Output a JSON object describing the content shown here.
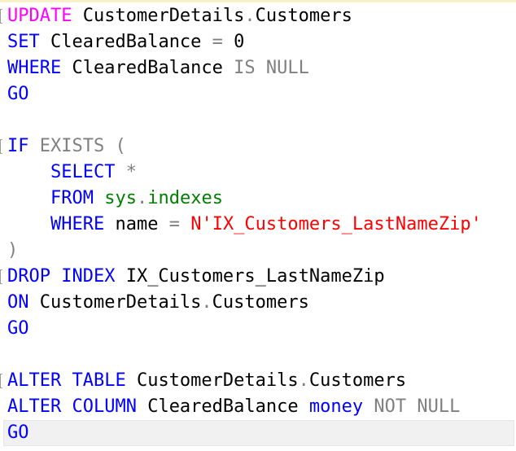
{
  "editor": {
    "colors": {
      "keyword": "#0000ff",
      "operator": "#808080",
      "function": "#ff00ff",
      "system": "#008000",
      "string": "#ff0000",
      "text": "#000000"
    },
    "lines": [
      {
        "tokens": [
          {
            "t": "UPDATE",
            "c": "fn"
          },
          {
            "t": " CustomerDetails",
            "c": "txt"
          },
          {
            "t": ".",
            "c": "op"
          },
          {
            "t": "Customers",
            "c": "txt"
          }
        ]
      },
      {
        "tokens": [
          {
            "t": "SET",
            "c": "kw"
          },
          {
            "t": " ClearedBalance ",
            "c": "txt"
          },
          {
            "t": "=",
            "c": "op"
          },
          {
            "t": " 0",
            "c": "txt"
          }
        ]
      },
      {
        "tokens": [
          {
            "t": "WHERE",
            "c": "kw"
          },
          {
            "t": " ClearedBalance ",
            "c": "txt"
          },
          {
            "t": "IS NULL",
            "c": "op"
          }
        ]
      },
      {
        "tokens": [
          {
            "t": "GO",
            "c": "kw"
          }
        ]
      },
      {
        "tokens": []
      },
      {
        "tokens": [
          {
            "t": "IF",
            "c": "kw"
          },
          {
            "t": " ",
            "c": "txt"
          },
          {
            "t": "EXISTS (",
            "c": "op"
          }
        ]
      },
      {
        "tokens": [
          {
            "t": "    ",
            "c": "txt"
          },
          {
            "t": "SELECT",
            "c": "kw"
          },
          {
            "t": " ",
            "c": "txt"
          },
          {
            "t": "*",
            "c": "op"
          }
        ]
      },
      {
        "tokens": [
          {
            "t": "    ",
            "c": "txt"
          },
          {
            "t": "FROM",
            "c": "kw"
          },
          {
            "t": " ",
            "c": "txt"
          },
          {
            "t": "sys",
            "c": "sys"
          },
          {
            "t": ".",
            "c": "op"
          },
          {
            "t": "indexes",
            "c": "sys"
          }
        ]
      },
      {
        "tokens": [
          {
            "t": "    ",
            "c": "txt"
          },
          {
            "t": "WHERE",
            "c": "kw"
          },
          {
            "t": " name ",
            "c": "txt"
          },
          {
            "t": "=",
            "c": "op"
          },
          {
            "t": " ",
            "c": "txt"
          },
          {
            "t": "N'IX_Customers_LastNameZip'",
            "c": "str"
          }
        ]
      },
      {
        "tokens": [
          {
            "t": ")",
            "c": "op"
          }
        ]
      },
      {
        "tokens": [
          {
            "t": "DROP INDEX",
            "c": "kw"
          },
          {
            "t": " IX_Customers_LastNameZip",
            "c": "txt"
          }
        ]
      },
      {
        "tokens": [
          {
            "t": "ON",
            "c": "kw"
          },
          {
            "t": " CustomerDetails",
            "c": "txt"
          },
          {
            "t": ".",
            "c": "op"
          },
          {
            "t": "Customers",
            "c": "txt"
          }
        ]
      },
      {
        "tokens": [
          {
            "t": "GO",
            "c": "kw"
          }
        ]
      },
      {
        "tokens": []
      },
      {
        "tokens": [
          {
            "t": "ALTER TABLE",
            "c": "kw"
          },
          {
            "t": " CustomerDetails",
            "c": "txt"
          },
          {
            "t": ".",
            "c": "op"
          },
          {
            "t": "Customers",
            "c": "txt"
          }
        ]
      },
      {
        "tokens": [
          {
            "t": "ALTER COLUMN",
            "c": "kw"
          },
          {
            "t": " ClearedBalance ",
            "c": "txt"
          },
          {
            "t": "money",
            "c": "kw"
          },
          {
            "t": " ",
            "c": "txt"
          },
          {
            "t": "NOT NULL",
            "c": "op"
          }
        ]
      },
      {
        "tokens": [
          {
            "t": "GO",
            "c": "kw"
          }
        ]
      }
    ]
  }
}
